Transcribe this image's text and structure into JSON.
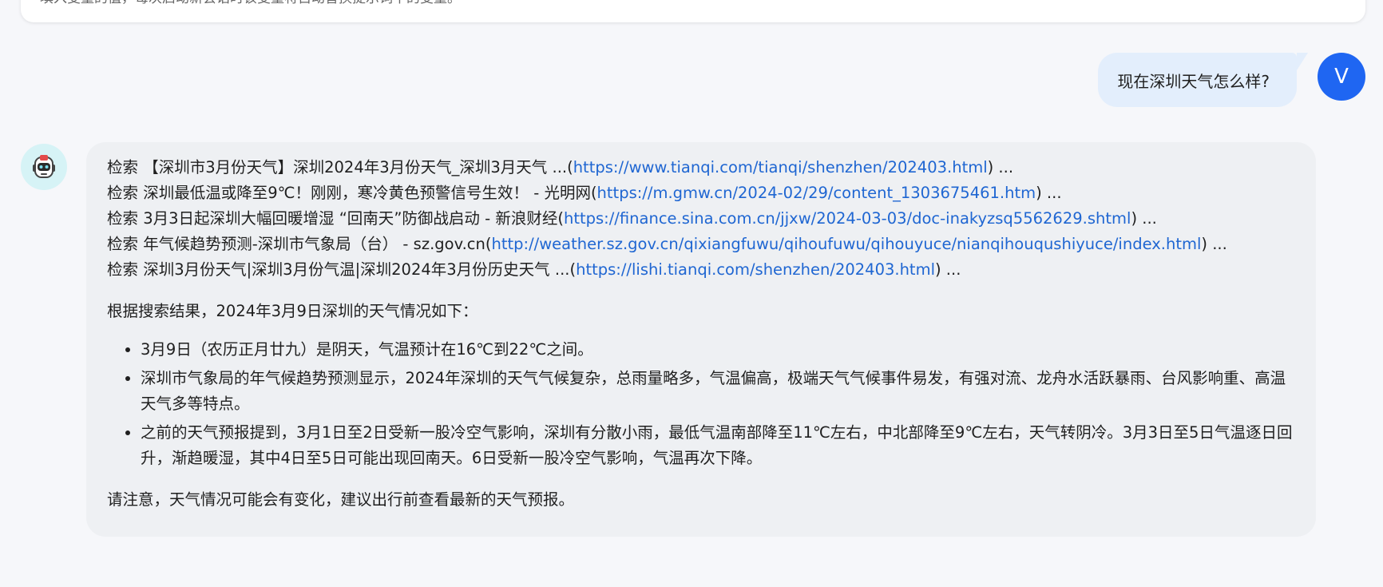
{
  "notice": {
    "text": "填入变量的值，每次启动新会话时该变量将自动替换提示词中的变量。"
  },
  "user_message": {
    "avatar_letter": "V",
    "text": "现在深圳天气怎么样?"
  },
  "assistant": {
    "avatar_icon": "robot-icon",
    "searches": [
      {
        "prefix": "检索 【深圳市3月份天气】深圳2024年3月份天气_深圳3月天气 ...(",
        "url": "https://www.tianqi.com/tianqi/shenzhen/202403.html",
        "suffix": ") ..."
      },
      {
        "prefix": "检索 深圳最低温或降至9℃！刚刚，寒冷黄色预警信号生效！ - 光明网(",
        "url": "https://m.gmw.cn/2024-02/29/content_1303675461.htm",
        "suffix": ") ..."
      },
      {
        "prefix": "检索 3月3日起深圳大幅回暖增湿 “回南天”防御战启动 - 新浪财经(",
        "url": "https://finance.sina.com.cn/jjxw/2024-03-03/doc-inakyzsq5562629.shtml",
        "suffix": ") ..."
      },
      {
        "prefix": "检索 年气候趋势预测-深圳市气象局（台） - sz.gov.cn(",
        "url": "http://weather.sz.gov.cn/qixiangfuwu/qihoufuwu/qihouyuce/nianqihouqushiyuce/index.html",
        "suffix": ") ..."
      },
      {
        "prefix": "检索 深圳3月份天气|深圳3月份气温|深圳2024年3月份历史天气 ...(",
        "url": "https://lishi.tianqi.com/shenzhen/202403.html",
        "suffix": ") ..."
      }
    ],
    "intro": "根据搜索结果，2024年3月9日深圳的天气情况如下：",
    "bullets": [
      "3月9日（农历正月廿九）是阴天，气温预计在16℃到22℃之间。",
      "深圳市气象局的年气候趋势预测显示，2024年深圳的天气气候复杂，总雨量略多，气温偏高，极端天气气候事件易发，有强对流、龙舟水活跃暴雨、台风影响重、高温天气多等特点。",
      "之前的天气预报提到，3月1日至2日受新一股冷空气影响，深圳有分散小雨，最低气温南部降至11℃左右，中北部降至9℃左右，天气转阴冷。3月3日至5日气温逐日回升，渐趋暖湿，其中4日至5日可能出现回南天。6日受新一股冷空气影响，气温再次下降。"
    ],
    "closing": "请注意，天气情况可能会有变化，建议出行前查看最新的天气预报。"
  },
  "colors": {
    "background": "#f6f7fa",
    "user_bubble": "#e3eefc",
    "user_avatar": "#1f66f2",
    "assistant_bubble": "#eef0f3",
    "link": "#1f66d2"
  }
}
